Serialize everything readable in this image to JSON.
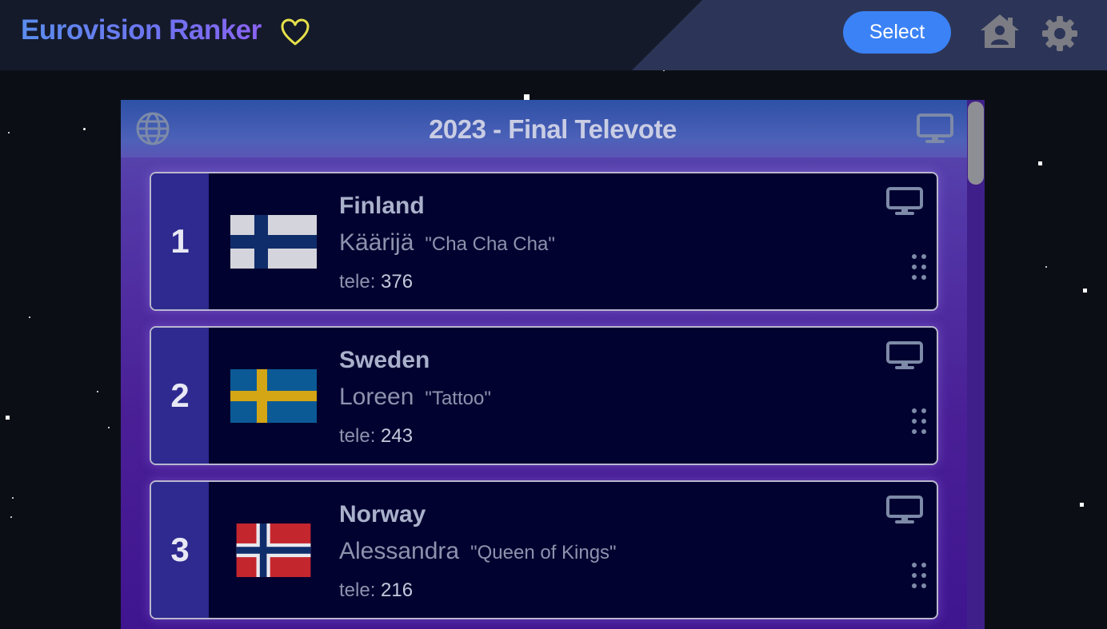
{
  "header": {
    "app_title": "Eurovision Ranker",
    "select_label": "Select",
    "heart_icon": "heart-icon",
    "home_icon": "home-icon",
    "settings_icon": "gear-icon"
  },
  "panel": {
    "title": "2023 - Final Televote",
    "globe_icon": "globe-icon",
    "tv_icon": "tv-icon"
  },
  "entries": [
    {
      "rank": "1",
      "country": "Finland",
      "artist": "Käärijä",
      "song": "\"Cha Cha Cha\"",
      "tele_label": "tele:",
      "tele_value": "376",
      "flag": "finland-flag"
    },
    {
      "rank": "2",
      "country": "Sweden",
      "artist": "Loreen",
      "song": "\"Tattoo\"",
      "tele_label": "tele:",
      "tele_value": "243",
      "flag": "sweden-flag"
    },
    {
      "rank": "3",
      "country": "Norway",
      "artist": "Alessandra",
      "song": "\"Queen of Kings\"",
      "tele_label": "tele:",
      "tele_value": "216",
      "flag": "norway-flag"
    }
  ],
  "colors": {
    "accent": "#3b82f6",
    "title_gradient_start": "#5b8dee",
    "title_gradient_end": "#8a63f2",
    "heart": "#e6e04a",
    "card_bg": "#020230",
    "rank_bg": "#2e2a8f"
  }
}
